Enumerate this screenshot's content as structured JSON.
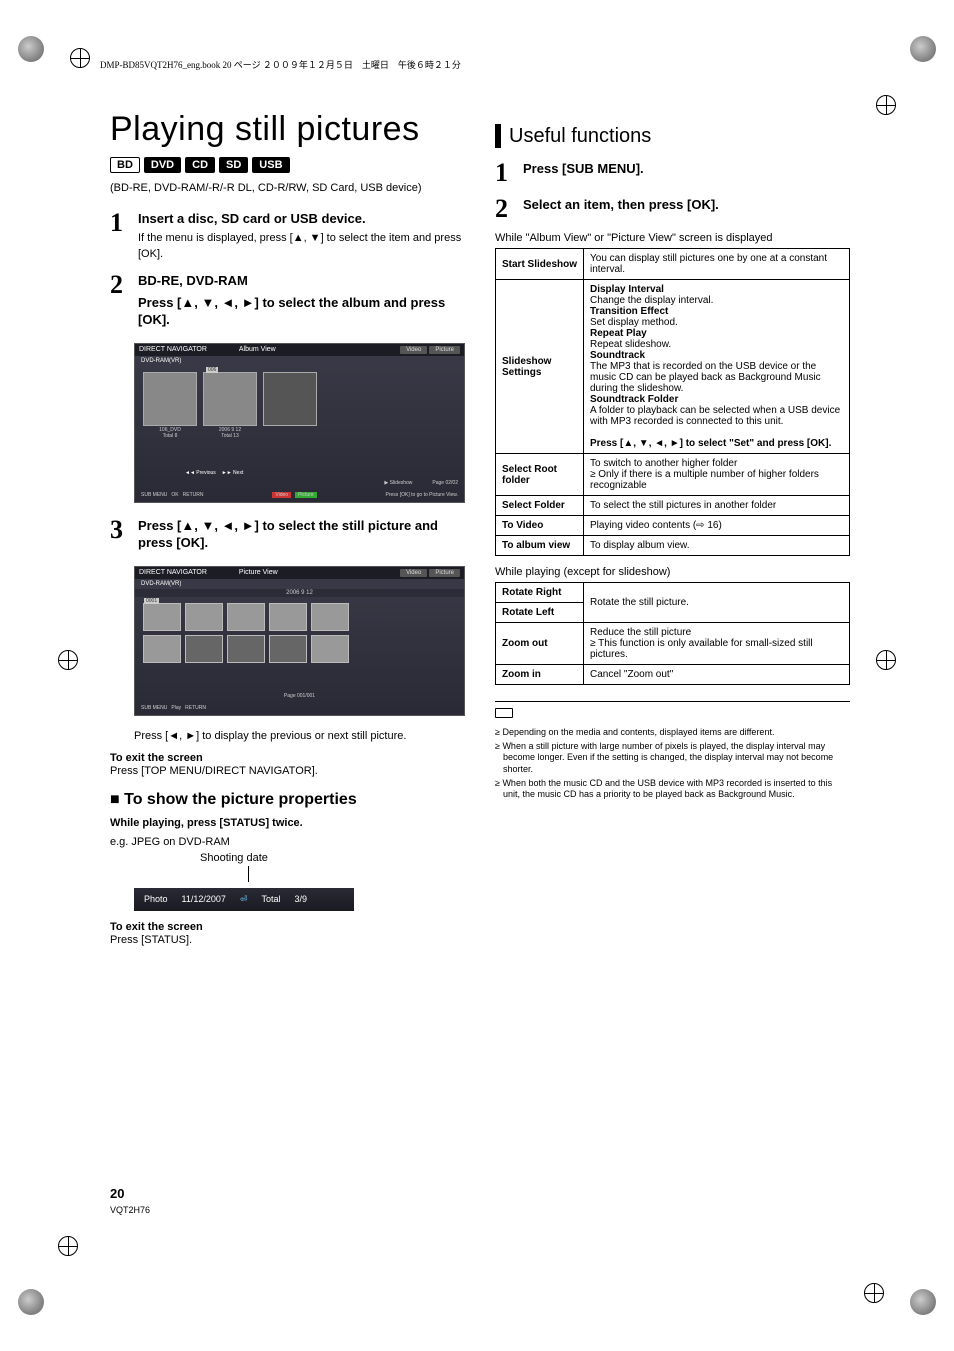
{
  "header_line": "DMP-BD85VQT2H76_eng.book  20 ページ  ２００９年１２月５日　土曜日　午後６時２１分",
  "title": "Playing still pictures",
  "badges": [
    "BD",
    "DVD",
    "CD",
    "SD",
    "USB"
  ],
  "intro": "(BD-RE, DVD-RAM/-R/-R DL, CD-R/RW, SD Card, USB device)",
  "steps": [
    {
      "num": "1",
      "head": "Insert a disc, SD card or USB device.",
      "sub": "If the menu is displayed, press [▲, ▼] to select the item and press [OK]."
    },
    {
      "num": "2",
      "head_pre": "BD-RE, DVD-RAM",
      "head": "Press [▲, ▼, ◄, ►] to select the album and press [OK]."
    },
    {
      "num": "3",
      "head": "Press [▲, ▼, ◄, ►] to select the still picture and press [OK]."
    }
  ],
  "album_view": {
    "nav": "DIRECT NAVIGATOR",
    "mode": "Album View",
    "source": "DVD-RAM(VR)",
    "tabs": [
      "Video",
      "Picture"
    ],
    "tile1": {
      "name": "106_DVD",
      "count": "Total 8"
    },
    "tile2": {
      "date": "2006  9 12",
      "count": "Total 13",
      "badge": "006"
    },
    "page": "Page   02/02",
    "prev": "Previous",
    "next": "Next",
    "slideshow": "Slideshow",
    "sub_menu": "SUB MENU",
    "ok": "OK",
    "return": "RETURN",
    "btn_video": "Video",
    "btn_picture": "Picture",
    "hint": "Press [OK] to go to Picture View."
  },
  "picture_view": {
    "nav": "DIRECT NAVIGATOR",
    "mode": "Picture View",
    "source": "DVD-RAM(VR)",
    "tabs": [
      "Video",
      "Picture"
    ],
    "date": "2006  9 12",
    "badge": "0001",
    "page": "Page  001/001",
    "sub_menu": "SUB MENU",
    "play": "Play",
    "return": "RETURN"
  },
  "step3_note": "Press [◄, ►] to display the previous or next still picture.",
  "exit1": {
    "label": "To exit the screen",
    "body": "Press [TOP MENU/DIRECT NAVIGATOR]."
  },
  "properties": {
    "heading": "To show the picture properties",
    "while": "While playing, press [STATUS] twice.",
    "eg": "e.g. JPEG on DVD-RAM",
    "pointer": "Shooting date",
    "row": {
      "photo": "Photo",
      "date": "11/12/2007",
      "total": "Total",
      "count": "3/9"
    }
  },
  "exit2": {
    "label": "To exit the screen",
    "body": "Press [STATUS]."
  },
  "right": {
    "heading": "Useful functions",
    "step1": {
      "num": "1",
      "text": "Press [SUB MENU]."
    },
    "step2": {
      "num": "2",
      "text": "Select an item, then press [OK]."
    },
    "caption1": "While \"Album View\" or \"Picture View\" screen is displayed",
    "table1": [
      {
        "label": "Start Slideshow",
        "body": [
          "You can display still pictures one by one at a constant interval."
        ]
      },
      {
        "label": "Slideshow Settings",
        "body": [
          {
            "strong": "Display Interval"
          },
          "Change the display interval.",
          {
            "strong": "Transition Effect"
          },
          "Set display method.",
          {
            "strong": "Repeat Play"
          },
          "Repeat slideshow.",
          {
            "strong": "Soundtrack"
          },
          "The MP3 that is recorded on the USB device or the music CD can be played back as Background Music during the slideshow.",
          {
            "strong": "Soundtrack Folder"
          },
          "A folder to playback can be selected when a USB device with MP3 recorded is connected to this unit.",
          "",
          {
            "strong": "Press [▲, ▼, ◄, ►] to select \"Set\" and press [OK]."
          }
        ]
      },
      {
        "label": "Select Root folder",
        "body": [
          "To switch to another higher folder",
          "≥ Only if there is a multiple number of higher folders recognizable"
        ]
      },
      {
        "label": "Select Folder",
        "body": [
          "To select the still pictures in another folder"
        ]
      },
      {
        "label": "To Video",
        "body": [
          "Playing video contents (⇨ 16)"
        ]
      },
      {
        "label": "To album view",
        "body": [
          "To display album view."
        ]
      }
    ],
    "caption2": "While playing (except for slideshow)",
    "table2": [
      {
        "label": "Rotate Right",
        "rowspan_body": "Rotate the still picture."
      },
      {
        "label": "Rotate Left"
      },
      {
        "label": "Zoom out",
        "body": [
          "Reduce the still picture",
          "≥ This function is only available for small-sized still pictures."
        ]
      },
      {
        "label": "Zoom in",
        "body": [
          "Cancel \"Zoom out\""
        ]
      }
    ],
    "footnotes": [
      "≥ Depending on the media and contents, displayed items are different.",
      "≥ When a still picture with large number of pixels is played, the display interval may become longer. Even if the setting is changed, the display interval may not become shorter.",
      "≥ When both the music CD and the USB device with MP3 recorded is inserted to this unit, the music CD has a priority to be played back as Background Music."
    ]
  },
  "page_num": "20",
  "page_code": "VQT2H76"
}
